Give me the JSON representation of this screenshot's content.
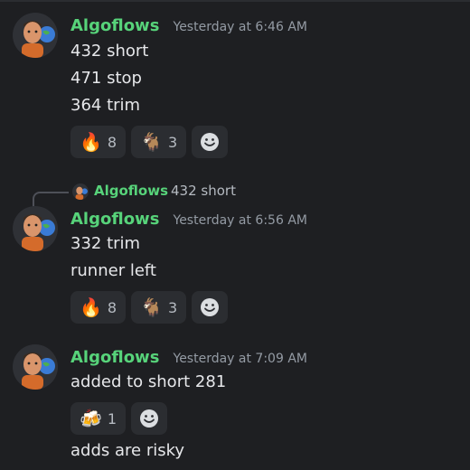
{
  "colors": {
    "background": "#1e1f22",
    "username": "#57d37a",
    "timestamp": "#949ba4",
    "message_text": "#e6e7ea",
    "reaction_bg": "#2b2d31"
  },
  "messages": [
    {
      "author": "Algoflows",
      "timestamp": "Yesterday at 6:46 AM",
      "lines": [
        "432 short",
        "471 stop",
        "364 trim"
      ],
      "reactions": [
        {
          "emoji": "🔥",
          "icon": "fire-emoji",
          "count": "8"
        },
        {
          "emoji": "🐐",
          "icon": "goat-emoji",
          "count": "3"
        }
      ]
    },
    {
      "reply": {
        "author": "Algoflows",
        "text": "432 short"
      },
      "author": "Algoflows",
      "timestamp": "Yesterday at 6:56 AM",
      "lines": [
        "332 trim",
        "runner left"
      ],
      "reactions": [
        {
          "emoji": "🔥",
          "icon": "fire-emoji",
          "count": "8"
        },
        {
          "emoji": "🐐",
          "icon": "goat-emoji",
          "count": "3"
        }
      ]
    },
    {
      "author": "Algoflows",
      "timestamp": "Yesterday at 7:09 AM",
      "lines": [
        "added to short 281"
      ],
      "reactions": [
        {
          "emoji": "🍻",
          "icon": "beers-emoji",
          "count": "1"
        }
      ],
      "after_lines": [
        "adds are risky"
      ]
    }
  ]
}
